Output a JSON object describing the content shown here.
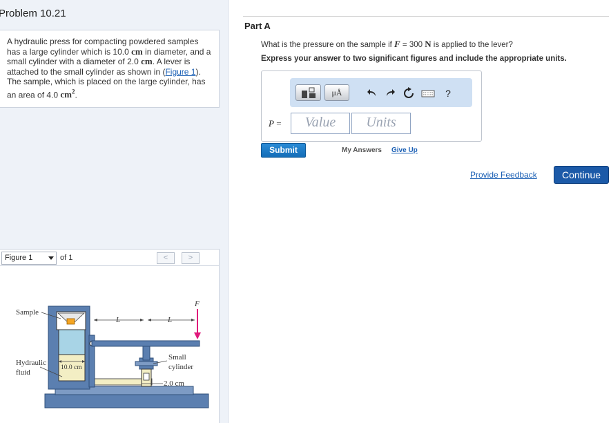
{
  "problem": {
    "title": "Problem 10.21",
    "text_1": "A hydraulic press for compacting powdered samples has a large cylinder which is 10.0 ",
    "unit_cm_1": "cm",
    "text_2": " in diameter, and a small cylinder with a diameter of 2.0 ",
    "unit_cm_2": "cm",
    "text_3": ". A lever is attached to the small cylinder as shown in (",
    "figure_link": "Figure 1",
    "text_4": "). The sample, which is placed on the large cylinder, has an area of 4.0 ",
    "unit_area": "cm",
    "unit_area_exp": "2",
    "text_5": "."
  },
  "figure_nav": {
    "selected": "Figure 1",
    "of_label": "of 1",
    "prev": "<",
    "next": ">"
  },
  "figure": {
    "label_sample": "Sample",
    "label_fluid_1": "Hydraulic",
    "label_fluid_2": "fluid",
    "label_large_diam": "10.0 cm",
    "label_L1": "L",
    "label_L2": "L",
    "label_F": "F",
    "label_small_1": "Small",
    "label_small_2": "cylinder",
    "label_small_diam": "2.0 cm",
    "colors": {
      "frame": "#5b7fb0",
      "frame_dark": "#3e6291",
      "cylinder": "#a8d4e6",
      "fluid": "#f3eec4",
      "sample": "#f5a623",
      "force_arrow": "#e0197b"
    }
  },
  "part_a": {
    "title": "Part A",
    "question_1": "What is the pressure on the sample if ",
    "question_var": "F",
    "question_2": " = 300  ",
    "question_unit": "N",
    "question_3": " is applied to the lever?",
    "instructions": "Express your answer to two significant figures and include the appropriate units."
  },
  "answer": {
    "toolbar_units_label": "μÅ",
    "icons": [
      "template-icon",
      "units-icon",
      "undo-icon",
      "redo-icon",
      "reset-icon",
      "keyboard-icon",
      "help-icon"
    ],
    "help_label": "?",
    "var_label": "P",
    "equals": " =",
    "value_placeholder": "Value",
    "units_placeholder": "Units"
  },
  "actions": {
    "submit": "Submit",
    "my_answers": "My Answers",
    "give_up": "Give Up",
    "provide_feedback": "Provide Feedback",
    "continue": "Continue"
  }
}
